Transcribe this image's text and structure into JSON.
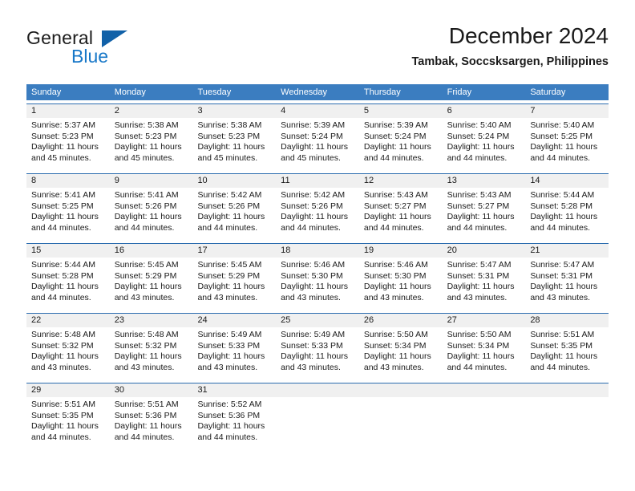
{
  "brand": {
    "name_part1": "General",
    "name_part2": "Blue",
    "flag_icon": "triangle-flag-icon"
  },
  "header": {
    "title": "December 2024",
    "location": "Tambak, Soccsksargen, Philippines"
  },
  "colors": {
    "header_blue": "#3b7dc0",
    "week_divider_blue": "#2b6caf",
    "daynum_band": "#f0f0f0",
    "brand_blue": "#1878c8",
    "text": "#1a1a1a"
  },
  "weekdays": [
    "Sunday",
    "Monday",
    "Tuesday",
    "Wednesday",
    "Thursday",
    "Friday",
    "Saturday"
  ],
  "weeks": [
    {
      "days": [
        {
          "num": "1",
          "sunrise": "Sunrise: 5:37 AM",
          "sunset": "Sunset: 5:23 PM",
          "daylight": "Daylight: 11 hours and 45 minutes."
        },
        {
          "num": "2",
          "sunrise": "Sunrise: 5:38 AM",
          "sunset": "Sunset: 5:23 PM",
          "daylight": "Daylight: 11 hours and 45 minutes."
        },
        {
          "num": "3",
          "sunrise": "Sunrise: 5:38 AM",
          "sunset": "Sunset: 5:23 PM",
          "daylight": "Daylight: 11 hours and 45 minutes."
        },
        {
          "num": "4",
          "sunrise": "Sunrise: 5:39 AM",
          "sunset": "Sunset: 5:24 PM",
          "daylight": "Daylight: 11 hours and 45 minutes."
        },
        {
          "num": "5",
          "sunrise": "Sunrise: 5:39 AM",
          "sunset": "Sunset: 5:24 PM",
          "daylight": "Daylight: 11 hours and 44 minutes."
        },
        {
          "num": "6",
          "sunrise": "Sunrise: 5:40 AM",
          "sunset": "Sunset: 5:24 PM",
          "daylight": "Daylight: 11 hours and 44 minutes."
        },
        {
          "num": "7",
          "sunrise": "Sunrise: 5:40 AM",
          "sunset": "Sunset: 5:25 PM",
          "daylight": "Daylight: 11 hours and 44 minutes."
        }
      ]
    },
    {
      "days": [
        {
          "num": "8",
          "sunrise": "Sunrise: 5:41 AM",
          "sunset": "Sunset: 5:25 PM",
          "daylight": "Daylight: 11 hours and 44 minutes."
        },
        {
          "num": "9",
          "sunrise": "Sunrise: 5:41 AM",
          "sunset": "Sunset: 5:26 PM",
          "daylight": "Daylight: 11 hours and 44 minutes."
        },
        {
          "num": "10",
          "sunrise": "Sunrise: 5:42 AM",
          "sunset": "Sunset: 5:26 PM",
          "daylight": "Daylight: 11 hours and 44 minutes."
        },
        {
          "num": "11",
          "sunrise": "Sunrise: 5:42 AM",
          "sunset": "Sunset: 5:26 PM",
          "daylight": "Daylight: 11 hours and 44 minutes."
        },
        {
          "num": "12",
          "sunrise": "Sunrise: 5:43 AM",
          "sunset": "Sunset: 5:27 PM",
          "daylight": "Daylight: 11 hours and 44 minutes."
        },
        {
          "num": "13",
          "sunrise": "Sunrise: 5:43 AM",
          "sunset": "Sunset: 5:27 PM",
          "daylight": "Daylight: 11 hours and 44 minutes."
        },
        {
          "num": "14",
          "sunrise": "Sunrise: 5:44 AM",
          "sunset": "Sunset: 5:28 PM",
          "daylight": "Daylight: 11 hours and 44 minutes."
        }
      ]
    },
    {
      "days": [
        {
          "num": "15",
          "sunrise": "Sunrise: 5:44 AM",
          "sunset": "Sunset: 5:28 PM",
          "daylight": "Daylight: 11 hours and 44 minutes."
        },
        {
          "num": "16",
          "sunrise": "Sunrise: 5:45 AM",
          "sunset": "Sunset: 5:29 PM",
          "daylight": "Daylight: 11 hours and 43 minutes."
        },
        {
          "num": "17",
          "sunrise": "Sunrise: 5:45 AM",
          "sunset": "Sunset: 5:29 PM",
          "daylight": "Daylight: 11 hours and 43 minutes."
        },
        {
          "num": "18",
          "sunrise": "Sunrise: 5:46 AM",
          "sunset": "Sunset: 5:30 PM",
          "daylight": "Daylight: 11 hours and 43 minutes."
        },
        {
          "num": "19",
          "sunrise": "Sunrise: 5:46 AM",
          "sunset": "Sunset: 5:30 PM",
          "daylight": "Daylight: 11 hours and 43 minutes."
        },
        {
          "num": "20",
          "sunrise": "Sunrise: 5:47 AM",
          "sunset": "Sunset: 5:31 PM",
          "daylight": "Daylight: 11 hours and 43 minutes."
        },
        {
          "num": "21",
          "sunrise": "Sunrise: 5:47 AM",
          "sunset": "Sunset: 5:31 PM",
          "daylight": "Daylight: 11 hours and 43 minutes."
        }
      ]
    },
    {
      "days": [
        {
          "num": "22",
          "sunrise": "Sunrise: 5:48 AM",
          "sunset": "Sunset: 5:32 PM",
          "daylight": "Daylight: 11 hours and 43 minutes."
        },
        {
          "num": "23",
          "sunrise": "Sunrise: 5:48 AM",
          "sunset": "Sunset: 5:32 PM",
          "daylight": "Daylight: 11 hours and 43 minutes."
        },
        {
          "num": "24",
          "sunrise": "Sunrise: 5:49 AM",
          "sunset": "Sunset: 5:33 PM",
          "daylight": "Daylight: 11 hours and 43 minutes."
        },
        {
          "num": "25",
          "sunrise": "Sunrise: 5:49 AM",
          "sunset": "Sunset: 5:33 PM",
          "daylight": "Daylight: 11 hours and 43 minutes."
        },
        {
          "num": "26",
          "sunrise": "Sunrise: 5:50 AM",
          "sunset": "Sunset: 5:34 PM",
          "daylight": "Daylight: 11 hours and 43 minutes."
        },
        {
          "num": "27",
          "sunrise": "Sunrise: 5:50 AM",
          "sunset": "Sunset: 5:34 PM",
          "daylight": "Daylight: 11 hours and 44 minutes."
        },
        {
          "num": "28",
          "sunrise": "Sunrise: 5:51 AM",
          "sunset": "Sunset: 5:35 PM",
          "daylight": "Daylight: 11 hours and 44 minutes."
        }
      ]
    },
    {
      "days": [
        {
          "num": "29",
          "sunrise": "Sunrise: 5:51 AM",
          "sunset": "Sunset: 5:35 PM",
          "daylight": "Daylight: 11 hours and 44 minutes."
        },
        {
          "num": "30",
          "sunrise": "Sunrise: 5:51 AM",
          "sunset": "Sunset: 5:36 PM",
          "daylight": "Daylight: 11 hours and 44 minutes."
        },
        {
          "num": "31",
          "sunrise": "Sunrise: 5:52 AM",
          "sunset": "Sunset: 5:36 PM",
          "daylight": "Daylight: 11 hours and 44 minutes."
        },
        {
          "num": "",
          "sunrise": "",
          "sunset": "",
          "daylight": ""
        },
        {
          "num": "",
          "sunrise": "",
          "sunset": "",
          "daylight": ""
        },
        {
          "num": "",
          "sunrise": "",
          "sunset": "",
          "daylight": ""
        },
        {
          "num": "",
          "sunrise": "",
          "sunset": "",
          "daylight": ""
        }
      ]
    }
  ]
}
